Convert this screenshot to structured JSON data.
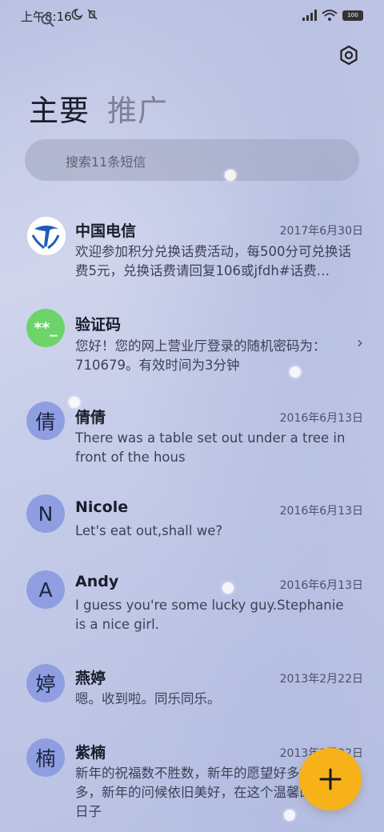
{
  "status_bar": {
    "time": "上午8:16",
    "left_icons": "☾ ✕",
    "battery": "100"
  },
  "tabs": [
    {
      "label": "主要",
      "active": true
    },
    {
      "label": "推广",
      "active": false
    }
  ],
  "search": {
    "placeholder": "搜索11条短信"
  },
  "messages": [
    {
      "sender": "中国电信",
      "date": "2017年6月30日",
      "avatar": "telecom-logo",
      "preview": "欢迎参加积分兑换话费活动，每500分可兑换话费5元，兑换话费请回复106或jfdh#话费…"
    },
    {
      "sender": "验证码",
      "date": "",
      "avatar": "**_",
      "avatar_color": "#6dd46a",
      "preview": "您好！您的网上营业厅登录的随机密码为：710679。有效时间为3分钟"
    },
    {
      "sender": "倩倩",
      "date": "2016年6月13日",
      "avatar": "倩",
      "preview": "There was a table set out under a tree in front of the hous"
    },
    {
      "sender": "Nicole",
      "date": "2016年6月13日",
      "avatar": "N",
      "preview": "Let's eat out,shall we?"
    },
    {
      "sender": "Andy",
      "date": "2016年6月13日",
      "avatar": "A",
      "preview": "I guess you're some lucky guy.Stephanie is a nice girl."
    },
    {
      "sender": "燕婷",
      "date": "2013年2月22日",
      "avatar": "婷",
      "preview": "嗯。收到啦。同乐同乐。"
    },
    {
      "sender": "紫楠",
      "date": "2013年2月22日",
      "avatar": "楠",
      "preview": "新年的祝福数不胜数，新年的愿望好多好多，新年的问候依旧美好，在这个温馨的日子"
    }
  ],
  "colors": {
    "accent": "#f7b21a",
    "avatar_bg": "#8e9ee0"
  },
  "icons": {
    "settings": "settings-icon",
    "search": "search-icon",
    "compose": "plus-icon",
    "chevron": "chevron-right-icon"
  }
}
